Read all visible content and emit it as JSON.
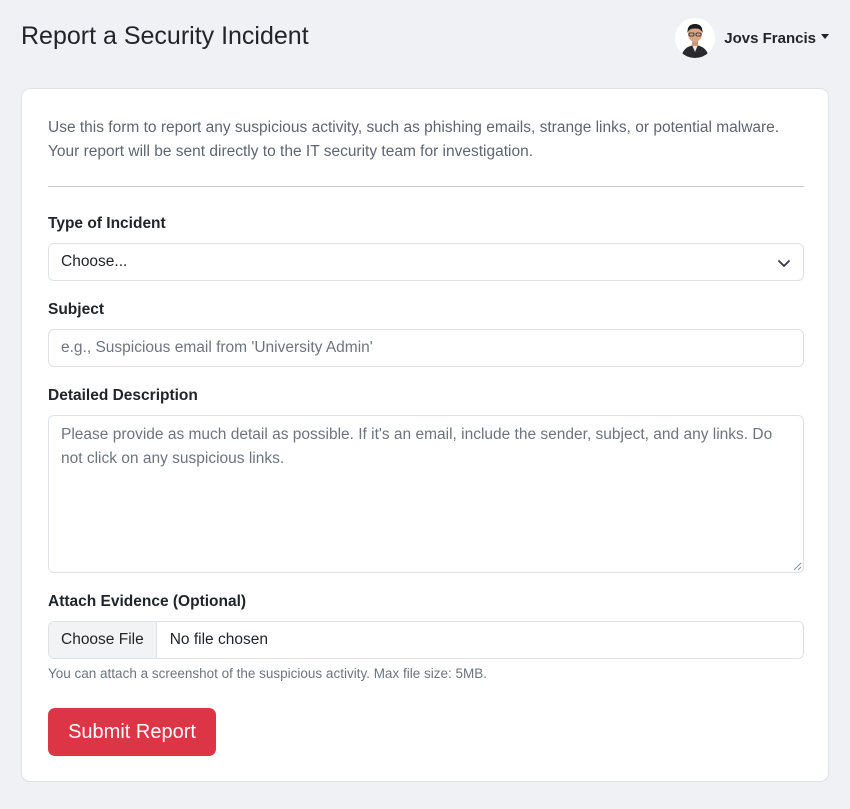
{
  "header": {
    "title": "Report a Security Incident",
    "user_name": "Jovs Francis"
  },
  "form": {
    "intro": "Use this form to report any suspicious activity, such as phishing emails, strange links, or potential malware. Your report will be sent directly to the IT security team for investigation.",
    "incident_type": {
      "label": "Type of Incident",
      "selected": "Choose..."
    },
    "subject": {
      "label": "Subject",
      "placeholder": "e.g., Suspicious email from 'University Admin'"
    },
    "description": {
      "label": "Detailed Description",
      "placeholder": "Please provide as much detail as possible. If it's an email, include the sender, subject, and any links. Do not click on any suspicious links."
    },
    "attachment": {
      "label": "Attach Evidence (Optional)",
      "button_label": "Choose File",
      "status": "No file chosen",
      "help": "You can attach a screenshot of the suspicious activity. Max file size: 5MB."
    },
    "submit_label": "Submit Report"
  },
  "colors": {
    "background": "#f0f1f5",
    "submit": "#dc3545"
  },
  "icons": {
    "select": "chevron-down-icon",
    "user_menu": "caret-down-icon"
  }
}
